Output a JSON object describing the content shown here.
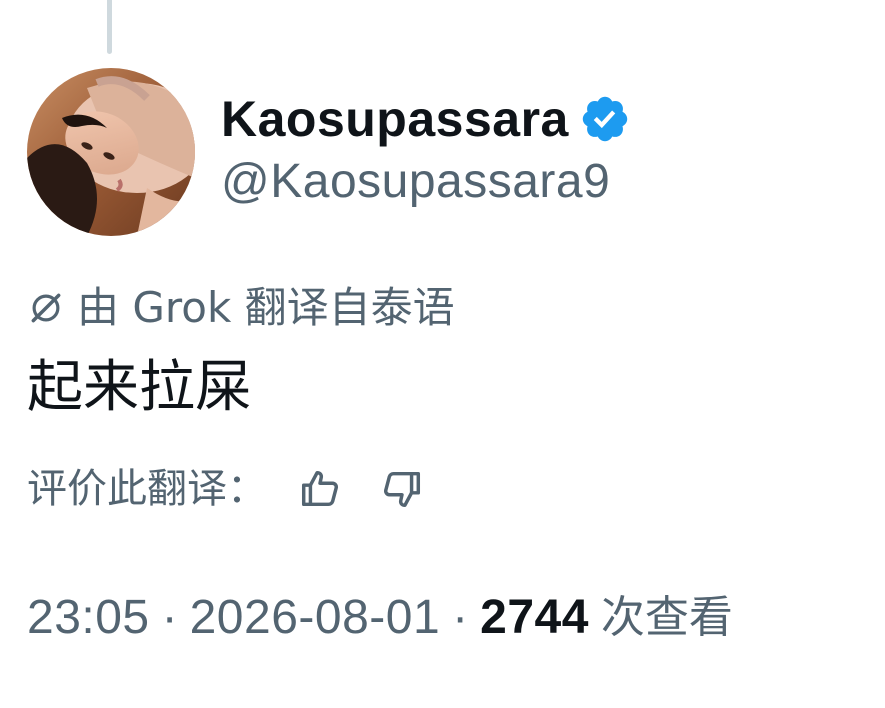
{
  "author": {
    "display_name": "Kaosupassara",
    "handle": "@Kaosupassara9",
    "verified": true,
    "avatar_icon": "profile-photo"
  },
  "translation": {
    "icon": "grok-icon",
    "label": "由 Grok 翻译自泰语"
  },
  "tweet": {
    "text": "起来拉屎"
  },
  "rating": {
    "label": "评价此翻译：",
    "up_icon": "thumbs-up-icon",
    "down_icon": "thumbs-down-icon"
  },
  "meta": {
    "time": "23:05",
    "date": "2026-08-01",
    "separator": "·",
    "views_count": "2744",
    "views_label": "次查看"
  },
  "colors": {
    "text_primary": "#0f1419",
    "text_secondary": "#536471",
    "verified_blue": "#1d9bf0",
    "thread_line": "#cfd9de"
  }
}
